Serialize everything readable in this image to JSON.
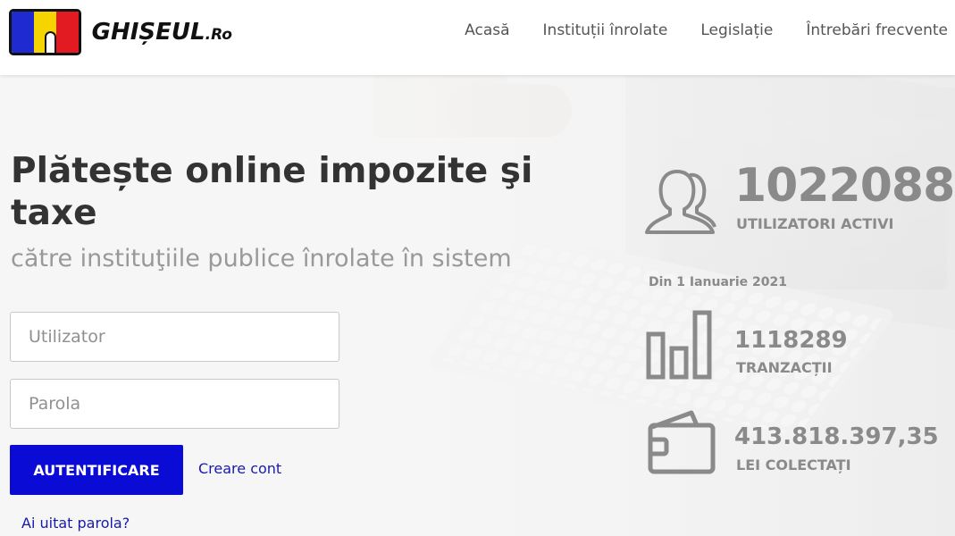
{
  "header": {
    "logo": {
      "text_main": "GHIȘEUL",
      "text_suffix": ".Ro",
      "flag_colors": [
        "#1f2bd1",
        "#f5d400",
        "#e21b22"
      ]
    },
    "nav": [
      {
        "label": "Acasă"
      },
      {
        "label": "Instituții înrolate"
      },
      {
        "label": "Legislație"
      },
      {
        "label": "Întrebări frecvente"
      }
    ]
  },
  "hero": {
    "title": "Plătește online impozite şi taxe",
    "subtitle": "către instituţiile publice înrolate în sistem"
  },
  "login": {
    "username_placeholder": "Utilizator",
    "username_value": "",
    "password_placeholder": "Parola",
    "password_value": "",
    "submit_label": "AUTENTIFICARE",
    "create_account_label": "Creare cont",
    "forgot_password_label": "Ai uitat parola?"
  },
  "stats": {
    "active_users": {
      "value": "1022088",
      "label": "UTILIZATORI ACTIVI",
      "icon": "users-icon"
    },
    "since_label": "Din 1 Ianuarie 2021",
    "transactions": {
      "value": "1118289",
      "label": "TRANZACȚII",
      "icon": "bar-chart-icon"
    },
    "collected": {
      "value": "413.818.397,35",
      "label": "LEI COLECTAȚI",
      "icon": "wallet-icon"
    }
  },
  "colors": {
    "primary_button": "#0b0bd6",
    "link": "#1a1aa8",
    "stat_text": "#8a8a8a",
    "nav_text": "#555555"
  }
}
